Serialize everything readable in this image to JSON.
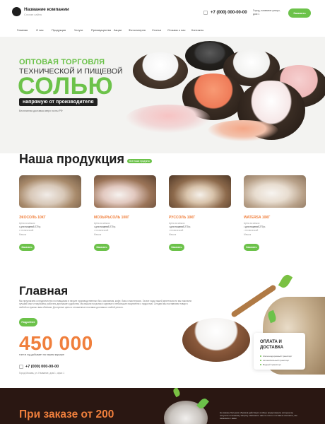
{
  "header": {
    "company_name": "Название компании",
    "company_sub": "Слоган сайта",
    "phone": "+7 (000) 000-00-00",
    "address": "Город, название улицы, дом 1",
    "callback_label": "Заказать звонок"
  },
  "nav": {
    "items": [
      "Главная",
      "О нас",
      "Продукция",
      "Услуги",
      "Преимущества",
      "Акции",
      "Фотогалерея",
      "Статьи",
      "Отзывы о нас",
      "Контакты"
    ]
  },
  "hero": {
    "title_line1": "ОПТОВАЯ ТОРГОВЛЯ",
    "title_line2": "ТЕХНИЧЕСКОЙ И ПИЩЕВОЙ",
    "title_big": "СОЛЬЮ",
    "badge": "напрямую от производителя",
    "note": "Бесплатная доставка сверх почты РФ"
  },
  "products": {
    "title": "Наша продукция",
    "tag": "Все наши продукты",
    "items": [
      {
        "name": "ЭКОСОЛЬ 10КГ",
        "l1": "Цена за мешок",
        "l2": "• для пищевой 270 р.",
        "l3": "• технической",
        "l4": "Мешок",
        "button": "Заказать"
      },
      {
        "name": "МОЗЫРЬСОЛЬ 10КГ",
        "l1": "Цена за мешок",
        "l2": "• для пищевой 270 р.",
        "l3": "• технической",
        "l4": "Мешок",
        "button": "Заказать"
      },
      {
        "name": "РУССОЛЬ 10КГ",
        "l1": "Цена за мешок",
        "l2": "• для пищевой 270 р.",
        "l3": "• технической",
        "l4": "Мешок",
        "button": "Заказать"
      },
      {
        "name": "WATERSA 10КГ",
        "l1": "Цена за мешок",
        "l2": "• для пищевой 270 р.",
        "l3": "• технической",
        "l4": "Мешок",
        "button": "Заказать"
      }
    ]
  },
  "main": {
    "title": "Главная",
    "text": "Мы предлагаем сотрудничество поставщикам в начале производственных баз, магазинам, кафе, базы и мастерских. За все годы нашей деятельности мы накопили лучший опыт и научились работать для вашего удобства. Мы вышли на рынок и крупные и небольшие покупатели с гордостью. Сегодня мы поставляем товар в любой из нужных вам объёмов. Доступные цены и отлаженные поставки доставка в любой регион.",
    "button": "Подробнее",
    "big_number": "450 000",
    "big_number_sub": "тонн в год добывает на нашем карьере",
    "phone": "+7 (000) 000-00-00",
    "address": "Город Москва, ул. Название, дом 1, офис 1",
    "delivery": {
      "title": "ОПЛАТА И ДОСТАВКА",
      "items": [
        "Железнодорожный транспорт",
        "Автомобильный транспорт",
        "Водный транспорт"
      ]
    }
  },
  "promo": {
    "title": "При заказе от 200",
    "text": "На заказы больших объёмов действуют особые предложения, которые вы получите по вашему запросу. Напишите нам по почте и оставьте контакты, мы свяжемся с вами."
  },
  "colors": {
    "accent_green": "#6cc24a",
    "accent_orange": "#f07f3c",
    "dark": "#1e1e1e"
  }
}
